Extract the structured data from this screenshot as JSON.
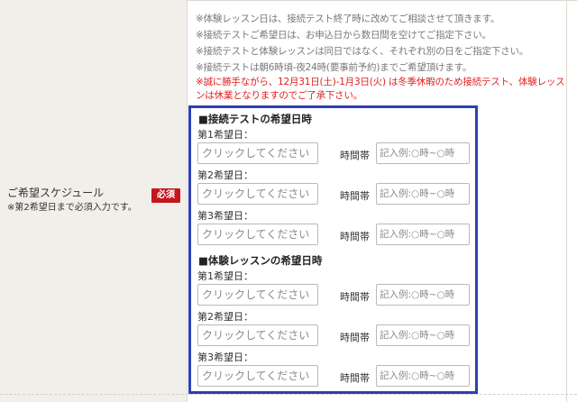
{
  "field": {
    "label": "ご希望スケジュール",
    "sub": "※第2希望日まで必須入力です。",
    "required": "必須"
  },
  "notes": [
    "※体験レッスン日は、接続テスト終了時に改めてご相談させて頂きます。",
    "※接続テストご希望日は、お申込日から数日間を空けてご指定下さい。",
    "※接続テストと体験レッスンは同日ではなく、それぞれ別の日をご指定下さい。",
    "※接続テストは朝6時頃-夜24時(要事前予約)までご希望頂けます。"
  ],
  "warning": "※誠に勝手ながら、12月31日(土)-1月3日(火) は冬季休暇のため接続テスト、体験レッスンは休業となりますのでご了承下さい。",
  "sections": [
    {
      "title": "■接続テストの希望日時",
      "rows": [
        {
          "label": "第1希望日：",
          "date_placeholder": "クリックしてください",
          "time_label": "時間帯",
          "time_placeholder": "記入例:○時~○時"
        },
        {
          "label": "第2希望日：",
          "date_placeholder": "クリックしてください",
          "time_label": "時間帯",
          "time_placeholder": "記入例:○時~○時"
        },
        {
          "label": "第3希望日：",
          "date_placeholder": "クリックしてください",
          "time_label": "時間帯",
          "time_placeholder": "記入例:○時~○時"
        }
      ]
    },
    {
      "title": "■体験レッスンの希望日時",
      "rows": [
        {
          "label": "第1希望日：",
          "date_placeholder": "クリックしてください",
          "time_label": "時間帯",
          "time_placeholder": "記入例:○時~○時"
        },
        {
          "label": "第2希望日：",
          "date_placeholder": "クリックしてください",
          "time_label": "時間帯",
          "time_placeholder": "記入例:○時~○時"
        },
        {
          "label": "第3希望日：",
          "date_placeholder": "クリックしてください",
          "time_label": "時間帯",
          "time_placeholder": "記入例:○時~○時"
        }
      ]
    }
  ],
  "colors": {
    "panel_border": "#2f3fb3",
    "required_badge": "#c4171d",
    "warning_text": "#e0201d",
    "label_background": "#f1efe9"
  }
}
